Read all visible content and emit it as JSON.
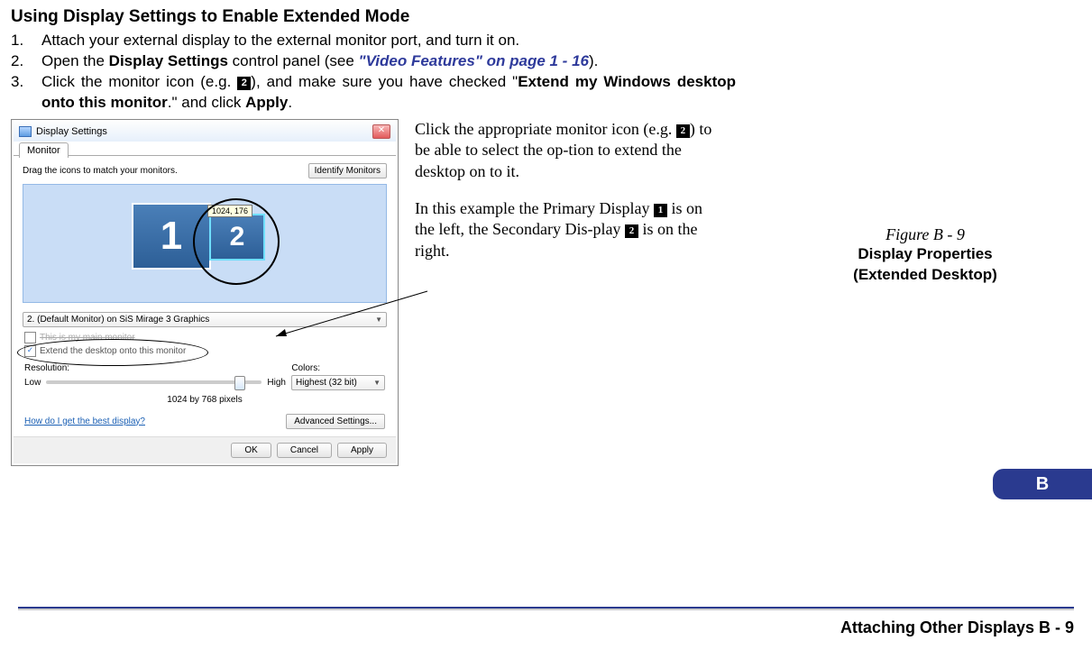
{
  "heading": "Using Display Settings to Enable Extended Mode",
  "steps": {
    "s1": {
      "num": "1.",
      "text": "Attach your external display to the external monitor port, and turn it on."
    },
    "s2": {
      "num": "2.",
      "pre": "Open the ",
      "bold1": "Display Settings",
      "mid": " control panel (see ",
      "link": "\"Video Features\" on page 1 - 16",
      "post": ")."
    },
    "s3": {
      "num": "3.",
      "pre": "Click the monitor icon (e.g. ",
      "badge1": "2",
      "mid": "), and make sure you have checked \"",
      "bold1": "Extend my Windows desktop onto this monitor",
      "post1": ".\" and click ",
      "bold2": "Apply",
      "post2": "."
    }
  },
  "dialog": {
    "title": "Display Settings",
    "tab": "Monitor",
    "drag_text": "Drag the icons to match your monitors.",
    "identify_btn": "Identify Monitors",
    "mon1": "1",
    "mon2": "2",
    "tooltip": "1024, 176",
    "monitor_select": "2. (Default Monitor) on SiS Mirage 3 Graphics",
    "main_monitor": "This is my main monitor",
    "extend": "Extend the desktop onto this monitor",
    "resolution_label": "Resolution:",
    "colors_label": "Colors:",
    "low": "Low",
    "high": "High",
    "colors_value": "Highest (32 bit)",
    "res_value": "1024 by 768 pixels",
    "best_display": "How do I get the best display?",
    "advanced": "Advanced Settings...",
    "ok": "OK",
    "cancel": "Cancel",
    "apply": "Apply"
  },
  "commentary": {
    "p1a": "Click the appropriate monitor icon (e.g. ",
    "p1badge": "2",
    "p1b": ") to be able to select the op-tion to extend the desktop on to it.",
    "p2a": "In this example the Primary Display ",
    "p2badge1": "1",
    "p2b": " is on the left, the Secondary Dis-play ",
    "p2badge2": "2",
    "p2c": " is on the right."
  },
  "figure": {
    "title": "Figure B - 9",
    "sub1": "Display Properties",
    "sub2": "(Extended Desktop)"
  },
  "side_tab": "B",
  "footer": "Attaching Other Displays  B  -  9"
}
